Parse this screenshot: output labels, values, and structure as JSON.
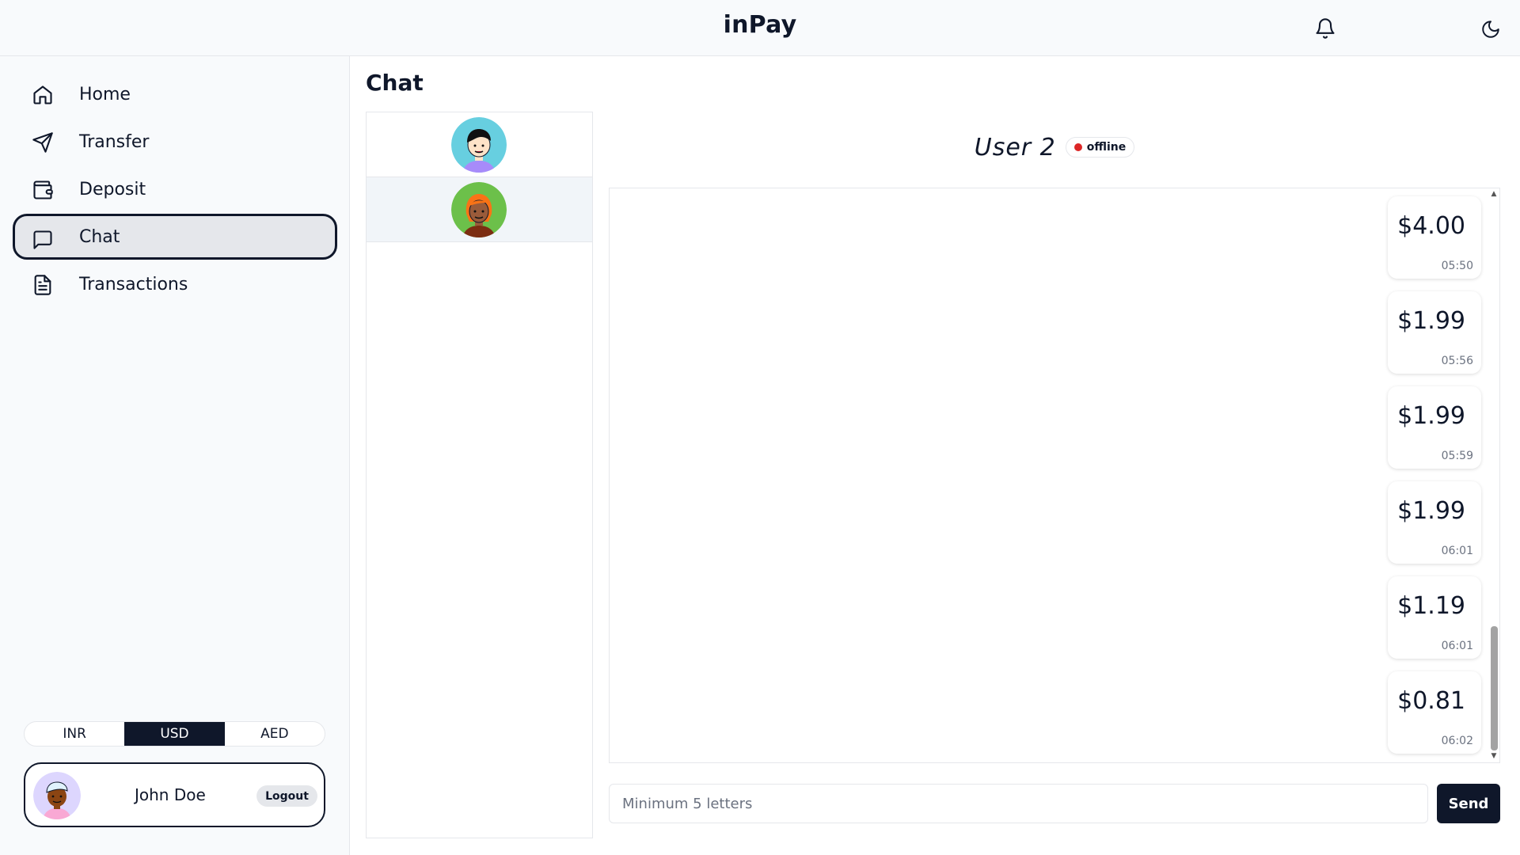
{
  "app": {
    "title": "inPay"
  },
  "header": {
    "bell_icon": "bell-icon",
    "theme_icon": "moon-icon"
  },
  "sidebar": {
    "items": [
      {
        "label": "Home",
        "icon": "home-icon",
        "active": false
      },
      {
        "label": "Transfer",
        "icon": "send-icon",
        "active": false
      },
      {
        "label": "Deposit",
        "icon": "wallet-icon",
        "active": false
      },
      {
        "label": "Chat",
        "icon": "chat-icon",
        "active": true
      },
      {
        "label": "Transactions",
        "icon": "document-icon",
        "active": false
      }
    ],
    "currencies": [
      {
        "label": "INR",
        "active": false
      },
      {
        "label": "USD",
        "active": true
      },
      {
        "label": "AED",
        "active": false
      }
    ],
    "user": {
      "name": "John Doe",
      "logout_label": "Logout"
    }
  },
  "main": {
    "title": "Chat",
    "contacts": [
      {
        "avatar": "avatar-girl-black-hair",
        "bg": "#67cfe0",
        "selected": false
      },
      {
        "avatar": "avatar-girl-orange-hair",
        "bg": "#6cc04a",
        "selected": true
      }
    ],
    "chat": {
      "user": "User 2",
      "status": "offline",
      "status_color": "#dc2626",
      "messages": [
        {
          "amount": "$4.00",
          "time": "05:50"
        },
        {
          "amount": "$1.99",
          "time": "05:56"
        },
        {
          "amount": "$1.99",
          "time": "05:59"
        },
        {
          "amount": "$1.99",
          "time": "06:01"
        },
        {
          "amount": "$1.19",
          "time": "06:01"
        },
        {
          "amount": "$0.81",
          "time": "06:02"
        }
      ]
    },
    "composer": {
      "placeholder": "Minimum 5 letters",
      "value": "",
      "send_label": "Send"
    }
  },
  "colors": {
    "primary": "#0f172a",
    "sidebar_bg": "#f8fafc",
    "border": "#e5e7eb",
    "offline": "#dc2626"
  }
}
